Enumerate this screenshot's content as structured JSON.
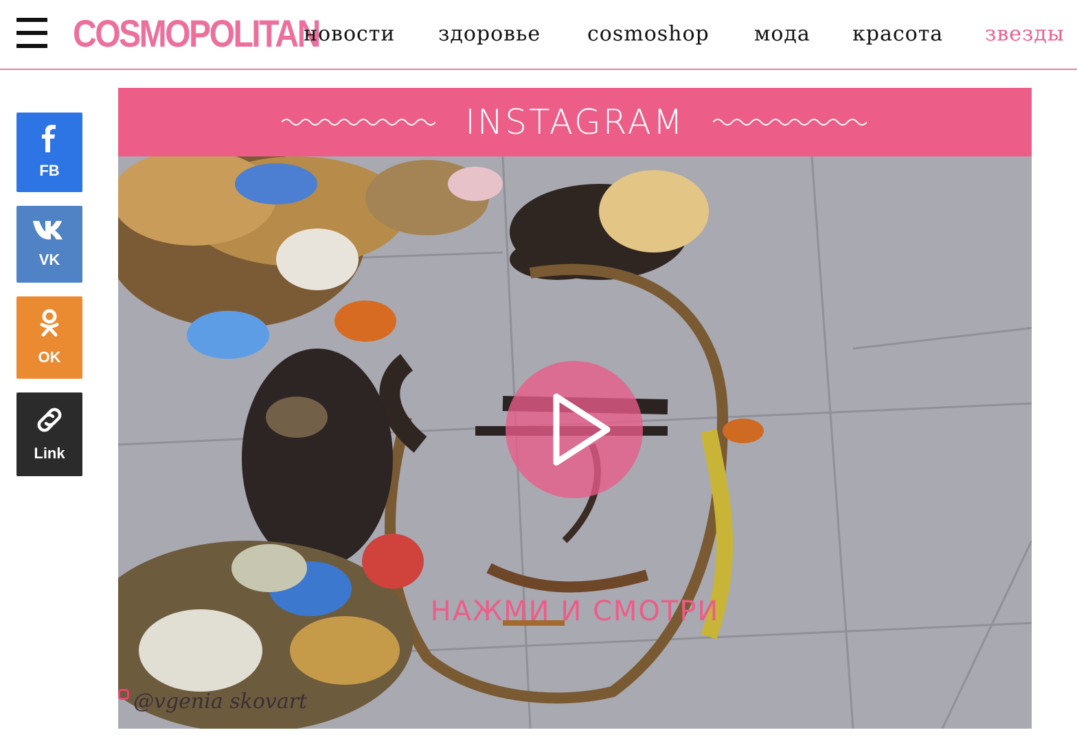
{
  "header": {
    "logo": "COSMOPOLITAN",
    "nav": [
      {
        "label": "новости"
      },
      {
        "label": "здоровье"
      },
      {
        "label": "cosmoshop"
      },
      {
        "label": "мода"
      },
      {
        "label": "красота"
      },
      {
        "label": "звезды"
      }
    ],
    "active_nav": "звезды",
    "menu_icon": "hamburger-menu-icon"
  },
  "share": {
    "fb": {
      "label": "FB",
      "icon": "facebook-icon",
      "color": "#2d74e4"
    },
    "vk": {
      "label": "VK",
      "icon": "vk-icon",
      "color": "#5082c6"
    },
    "ok": {
      "label": "OK",
      "icon": "odnoklassniki-icon",
      "color": "#ea8a31"
    },
    "link": {
      "label": "Link",
      "icon": "link-icon",
      "color": "#2b2b2b"
    }
  },
  "embed": {
    "banner_title": "INSTAGRAM",
    "banner_color": "#ec5d88",
    "cta": "НАЖМИ И СМОТРИ",
    "watermark": "@vgenia skovart",
    "play_icon": "play-icon"
  },
  "colors": {
    "accent": "#ec6f9c",
    "header_border": "#e87fa0"
  }
}
